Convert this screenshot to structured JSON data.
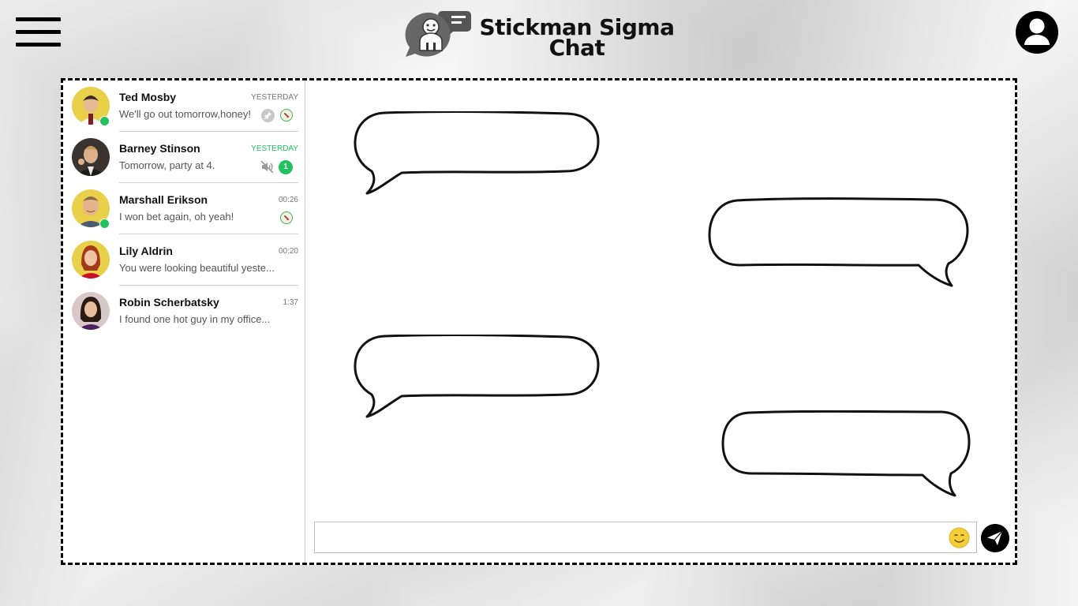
{
  "app": {
    "title_line1": "Stickman Sigma",
    "title_line2": "Chat"
  },
  "conversations": [
    {
      "name": "Ted Mosby",
      "time": "YESTERDAY",
      "message": "We'll go out tomorrow,honey!"
    },
    {
      "name": "Barney Stinson",
      "time": "YESTERDAY",
      "message": "Tomorrow, party at 4.",
      "unread": "1"
    },
    {
      "name": "Marshall Erikson",
      "time": "00:26",
      "message": "I won bet again, oh yeah!"
    },
    {
      "name": "Lily Aldrin",
      "time": "00:20",
      "message": "You were looking beautiful yeste..."
    },
    {
      "name": "Robin Scherbatsky",
      "time": "1:37",
      "message": "I found one hot guy in my office..."
    }
  ],
  "composer": {
    "value": "",
    "placeholder": ""
  },
  "icons": {
    "menu": "hamburger-menu-icon",
    "logo": "chat-bubble-logo-icon",
    "profile": "user-profile-icon",
    "pin": "pin-icon",
    "mute": "mute-icon",
    "emoji": "smiley-emoji-icon",
    "send": "paper-plane-send-icon"
  },
  "colors": {
    "online": "#22c35e",
    "unread_badge": "#22c35e",
    "accent": "#000000"
  }
}
